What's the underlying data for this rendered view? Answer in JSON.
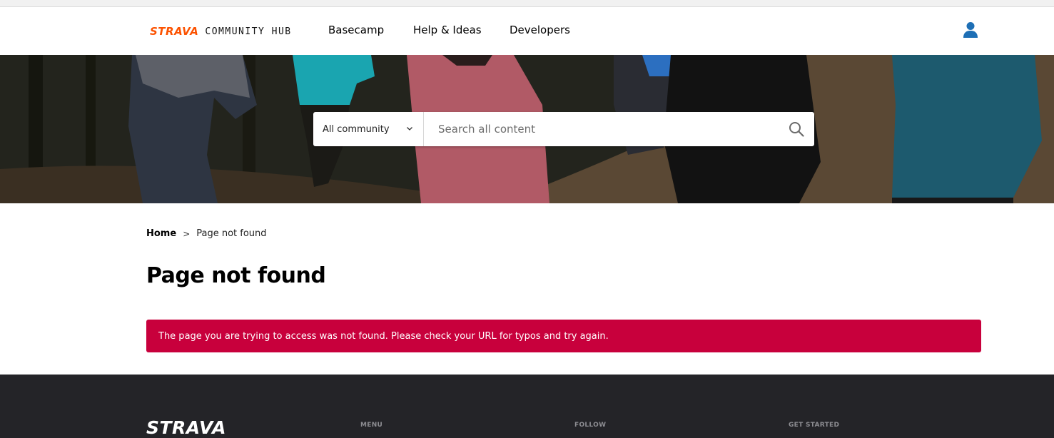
{
  "brand": {
    "logo_text": "STRAVA",
    "hub_text": "COMMUNITY HUB",
    "accent_color": "#fc5200"
  },
  "nav": {
    "items": [
      {
        "label": "Basecamp"
      },
      {
        "label": "Help & Ideas"
      },
      {
        "label": "Developers"
      }
    ],
    "user_icon": "user-icon"
  },
  "search": {
    "scope_selected": "All community",
    "placeholder": "Search all content",
    "icon": "search-icon"
  },
  "breadcrumb": {
    "home": "Home",
    "separator": ">",
    "current": "Page not found"
  },
  "page": {
    "title": "Page not found"
  },
  "alert": {
    "message": "The page you are trying to access was not found. Please check your URL for typos and try again.",
    "color": "#c8003c"
  },
  "footer": {
    "logo_text": "STRAVA",
    "headings": {
      "menu": "MENU",
      "follow": "FOLLOW",
      "get_started": "GET STARTED"
    },
    "background": "#242428"
  }
}
